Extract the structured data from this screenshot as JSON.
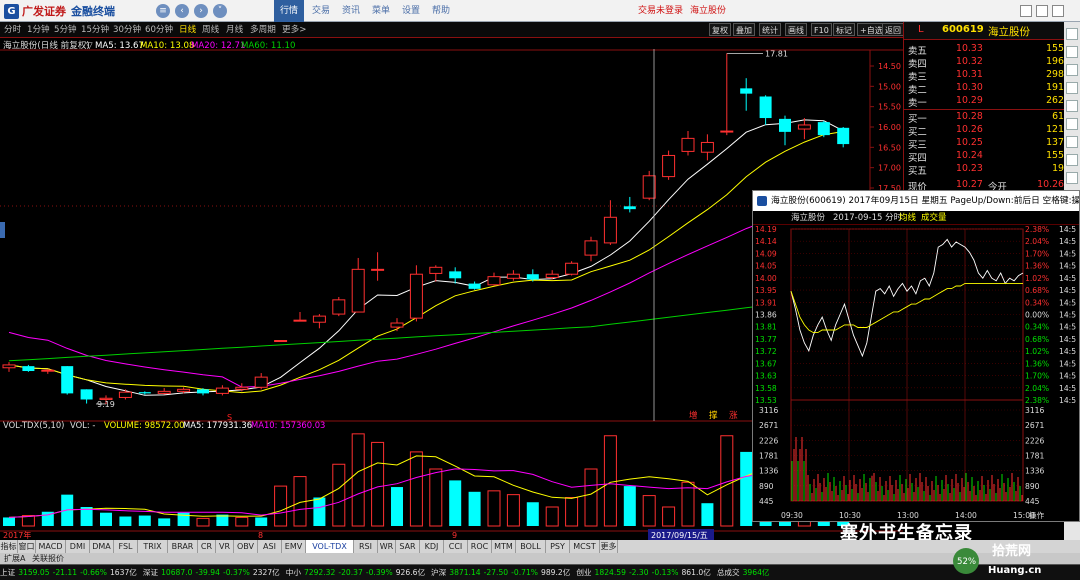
{
  "topbar": {
    "logo_cn": "广发证券",
    "logo_sub": "金融终端",
    "menus": [
      "行情",
      "交易",
      "资讯",
      "菜单",
      "设置",
      "帮助"
    ],
    "login_status": "交易未登录",
    "stock_name": "海立股份"
  },
  "period_tabs": [
    "分时",
    "1分钟",
    "5分钟",
    "15分钟",
    "30分钟",
    "60分钟",
    "日线",
    "周线",
    "月线",
    "多周期",
    "更多>"
  ],
  "active_tab": "日线",
  "toolbar": [
    "复权",
    "叠加",
    "统计",
    "画线",
    "F10",
    "标记",
    "+自选",
    "返回"
  ],
  "main": {
    "title": "海立股份(日线 前复权)",
    "arrow": "▽",
    "ma5": "MA5: 13.67",
    "ma10": "MA10: 13.08",
    "ma20": "MA20: 12.71",
    "ma60": "MA60: 11.10",
    "high_label": "17.81",
    "low_label": "9.19",
    "price_axis": [
      "17.50",
      "17.00",
      "16.50",
      "16.00",
      "15.50",
      "15.00",
      "14.50"
    ],
    "markers": [
      {
        "text": "S",
        "color": "#ff2020"
      },
      {
        "text": "增",
        "color": "#ff3030"
      },
      {
        "text": "撑",
        "color": "#ffd000"
      },
      {
        "text": "涨",
        "color": "#ff3030"
      }
    ],
    "year_label": "2017年",
    "month_labels": [
      "8",
      "9"
    ],
    "cursor_date": "2017/09/15/五"
  },
  "volume": {
    "title": "VOL-TDX(5,10)",
    "vol_name": "VOL: -",
    "volume": "VOLUME: 98572.00",
    "ma5": "MA5: 177931.36",
    "ma10": "MA10: 157360.03"
  },
  "bottom_tabs": [
    "指标",
    "窗口",
    "MACD",
    "DMI",
    "DMA",
    "FSL",
    "TRIX",
    "BRAR",
    "CR",
    "VR",
    "OBV",
    "ASI",
    "EMV",
    "VOL-TDX",
    "RSI",
    "WR",
    "SAR",
    "KDJ",
    "CCI",
    "ROC",
    "MTM",
    "BOLL",
    "PSY",
    "MCST",
    "更多"
  ],
  "active_bottom": "VOL-TDX",
  "ext_tabs": [
    "扩展A",
    "关联报价"
  ],
  "quote": {
    "badge": "L",
    "code": "600619",
    "name": "海立股份",
    "asks": [
      {
        "label": "卖五",
        "price": "10.33",
        "vol": "155"
      },
      {
        "label": "卖四",
        "price": "10.32",
        "vol": "196"
      },
      {
        "label": "卖三",
        "price": "10.31",
        "vol": "298"
      },
      {
        "label": "卖二",
        "price": "10.30",
        "vol": "191"
      },
      {
        "label": "卖一",
        "price": "10.29",
        "vol": "262"
      }
    ],
    "bids": [
      {
        "label": "买一",
        "price": "10.28",
        "vol": "61"
      },
      {
        "label": "买二",
        "price": "10.26",
        "vol": "121"
      },
      {
        "label": "买三",
        "price": "10.25",
        "vol": "137"
      },
      {
        "label": "买四",
        "price": "10.24",
        "vol": "155"
      },
      {
        "label": "买五",
        "price": "10.23",
        "vol": "19"
      }
    ],
    "last_label": "现价",
    "last": "10.27",
    "open_label": "今开",
    "open": "10.26"
  },
  "popup": {
    "title": "海立股份(600619) 2017年09月15日 星期五 PageUp/Down:前后日 空格键:操作 通",
    "sub_name": "海立股份",
    "sub_date": "2017-09-15 分时",
    "sub_avg": "均线",
    "sub_vol": "成交量",
    "price_axis": [
      "14.19",
      "14.14",
      "14.09",
      "14.05",
      "14.00",
      "13.95",
      "13.91",
      "13.86",
      "13.81",
      "13.77",
      "13.72",
      "13.67",
      "13.63",
      "13.58",
      "13.53"
    ],
    "pct_axis": [
      "2.38%",
      "2.04%",
      "1.70%",
      "1.36%",
      "1.02%",
      "0.68%",
      "0.34%",
      "0.00%",
      "0.34%",
      "0.68%",
      "1.02%",
      "1.36%",
      "1.70%",
      "2.04%",
      "2.38%"
    ],
    "vol_axis": [
      "3116",
      "2671",
      "2226",
      "1781",
      "1336",
      "890",
      "445"
    ],
    "time_axis": [
      "09:30",
      "10:30",
      "13:00",
      "14:00",
      "15:00"
    ],
    "op_label": "操作",
    "right_cut": "14:5"
  },
  "status_bar": [
    {
      "label": "上证",
      "value": "3159.05",
      "chg": "-21.11",
      "pct": "-0.66%",
      "amt": "1637亿"
    },
    {
      "label": "深证",
      "value": "10687.0",
      "chg": "-39.94",
      "pct": "-0.37%",
      "amt": "2327亿"
    },
    {
      "label": "中小",
      "value": "7292.32",
      "chg": "-20.37",
      "pct": "-0.39%",
      "amt": "926.6亿"
    },
    {
      "label": "沪深",
      "value": "3871.14",
      "chg": "-27.50",
      "pct": "-0.71%",
      "amt": "989.2亿"
    },
    {
      "label": "创业",
      "value": "1824.59",
      "chg": "-2.30",
      "pct": "-0.13%",
      "amt": "861.0亿"
    },
    {
      "label": "总成交",
      "value": "3964亿",
      "chg": "",
      "pct": "",
      "amt": ""
    }
  ],
  "watermark": "塞外书生备忘录",
  "right_labels": {
    "badge": "52%",
    "site": "Huang.cn",
    "site_cn": "拾荒网",
    "time": "6:54",
    "lev": "领航"
  },
  "colors": {
    "up": "#ff3030",
    "down": "#00ffff",
    "ma5": "#ffffff",
    "ma10": "#ffff00",
    "ma20": "#ff00ff",
    "ma60": "#00d000",
    "grid": "#8a1010"
  },
  "chart_data": [
    {
      "type": "candlestick",
      "title": "海立股份(日线 前复权)",
      "series": [
        {
          "name": "MA5",
          "last": 13.67
        },
        {
          "name": "MA10",
          "last": 13.08
        },
        {
          "name": "MA20",
          "last": 12.71
        },
        {
          "name": "MA60",
          "last": 11.1
        }
      ],
      "y_ticks": [
        14.5,
        15,
        15.5,
        16,
        16.5,
        17,
        17.5
      ],
      "high": 17.81,
      "low": 9.19,
      "candles": [
        [
          10.08,
          10.15,
          10.22,
          9.98
        ],
        [
          10.12,
          10.0,
          10.15,
          9.98
        ],
        [
          10.0,
          10.02,
          10.05,
          9.93
        ],
        [
          10.12,
          9.45,
          10.12,
          9.42
        ],
        [
          9.55,
          9.3,
          9.55,
          9.2
        ],
        [
          9.3,
          9.33,
          9.4,
          9.19
        ],
        [
          9.35,
          9.48,
          9.55,
          9.3
        ],
        [
          9.48,
          9.45,
          9.5,
          9.42
        ],
        [
          9.45,
          9.5,
          9.58,
          9.42
        ],
        [
          9.5,
          9.55,
          9.6,
          9.45
        ],
        [
          9.55,
          9.45,
          9.58,
          9.4
        ],
        [
          9.45,
          9.58,
          9.65,
          9.4
        ],
        [
          9.55,
          9.6,
          9.7,
          9.5
        ],
        [
          9.6,
          9.85,
          9.95,
          9.55
        ],
        [
          10.75,
          10.75,
          10.75,
          10.75
        ],
        [
          11.25,
          11.25,
          11.45,
          11.25
        ],
        [
          11.2,
          11.35,
          11.4,
          11.05
        ],
        [
          11.4,
          11.75,
          11.82,
          11.35
        ],
        [
          11.45,
          12.5,
          12.78,
          11.45
        ],
        [
          12.5,
          12.5,
          12.92,
          12.22
        ],
        [
          11.08,
          11.18,
          11.3,
          10.98
        ],
        [
          11.3,
          12.38,
          12.6,
          11.22
        ],
        [
          12.4,
          12.55,
          12.6,
          12.2
        ],
        [
          12.45,
          12.28,
          12.55,
          12.15
        ],
        [
          12.15,
          12.02,
          12.2,
          12.0
        ],
        [
          12.12,
          12.32,
          12.42,
          12.1
        ],
        [
          12.28,
          12.38,
          12.48,
          12.22
        ],
        [
          12.38,
          12.25,
          12.5,
          12.2
        ],
        [
          12.3,
          12.38,
          12.48,
          12.25
        ],
        [
          12.38,
          12.65,
          12.7,
          12.35
        ],
        [
          12.85,
          13.2,
          13.3,
          12.7
        ],
        [
          13.15,
          13.78,
          14.2,
          13.1
        ],
        [
          14.05,
          13.98,
          14.28,
          13.9
        ],
        [
          14.25,
          14.8,
          14.92,
          14.2
        ],
        [
          14.78,
          15.3,
          15.42,
          14.7
        ],
        [
          15.4,
          15.72,
          15.9,
          15.3
        ],
        [
          15.38,
          15.62,
          15.82,
          15.18
        ],
        [
          15.88,
          15.9,
          17.81,
          15.8
        ],
        [
          16.95,
          16.82,
          17.2,
          16.4
        ],
        [
          16.75,
          16.22,
          16.78,
          16.05
        ],
        [
          16.2,
          15.88,
          16.28,
          15.55
        ],
        [
          15.95,
          16.05,
          16.22,
          15.7
        ],
        [
          16.12,
          15.8,
          16.15,
          15.75
        ],
        [
          15.98,
          15.58,
          16.0,
          15.5
        ]
      ],
      "x_labels": [
        "2017年",
        "8",
        "9",
        "2017/09/15/五"
      ]
    },
    {
      "type": "bar",
      "title": "VOL-TDX(5,10)",
      "series": [
        {
          "name": "VOLUME",
          "last": 98572.0
        },
        {
          "name": "MA5",
          "last": 177931.36
        },
        {
          "name": "MA10",
          "last": 157360.03
        }
      ],
      "values": [
        {
          "v": 9,
          "up": false
        },
        {
          "v": 11,
          "up": true
        },
        {
          "v": 15,
          "up": false
        },
        {
          "v": 33,
          "up": false
        },
        {
          "v": 20,
          "up": false
        },
        {
          "v": 14,
          "up": false
        },
        {
          "v": 10,
          "up": false
        },
        {
          "v": 11,
          "up": false
        },
        {
          "v": 8,
          "up": false
        },
        {
          "v": 14,
          "up": false
        },
        {
          "v": 8,
          "up": true
        },
        {
          "v": 12,
          "up": false
        },
        {
          "v": 9,
          "up": true
        },
        {
          "v": 9,
          "up": false
        },
        {
          "v": 42,
          "up": true
        },
        {
          "v": 52,
          "up": true
        },
        {
          "v": 30,
          "up": false
        },
        {
          "v": 65,
          "up": true
        },
        {
          "v": 97,
          "up": true
        },
        {
          "v": 88,
          "up": true
        },
        {
          "v": 41,
          "up": false
        },
        {
          "v": 78,
          "up": true
        },
        {
          "v": 60,
          "up": true
        },
        {
          "v": 48,
          "up": false
        },
        {
          "v": 36,
          "up": false
        },
        {
          "v": 37,
          "up": true
        },
        {
          "v": 33,
          "up": true
        },
        {
          "v": 25,
          "up": false
        },
        {
          "v": 20,
          "up": true
        },
        {
          "v": 30,
          "up": true
        },
        {
          "v": 60,
          "up": true
        },
        {
          "v": 95,
          "up": true
        },
        {
          "v": 42,
          "up": false
        },
        {
          "v": 32,
          "up": true
        },
        {
          "v": 20,
          "up": true
        },
        {
          "v": 46,
          "up": true
        },
        {
          "v": 24,
          "up": false
        },
        {
          "v": 95,
          "up": true
        },
        {
          "v": 78,
          "up": false
        },
        {
          "v": 59,
          "up": false
        },
        {
          "v": 46,
          "up": false
        },
        {
          "v": 37,
          "up": true
        },
        {
          "v": 33,
          "up": false
        },
        {
          "v": 28,
          "up": false
        }
      ]
    },
    {
      "type": "line",
      "title": "海立股份 2017-09-15 分时",
      "y_ticks": [
        14.19,
        14.14,
        14.09,
        14.05,
        14.0,
        13.95,
        13.91,
        13.86,
        13.81,
        13.77,
        13.72,
        13.67,
        13.63,
        13.58,
        13.53
      ],
      "base_price": 13.86,
      "price": [
        13.95,
        13.88,
        13.8,
        13.75,
        13.72,
        13.78,
        13.82,
        13.85,
        13.8,
        13.76,
        13.82,
        13.86,
        13.9,
        13.84,
        13.78,
        13.74,
        13.7,
        13.75,
        13.85,
        13.95,
        13.96,
        13.94,
        13.97,
        13.93,
        13.96,
        13.98,
        13.95,
        13.97,
        13.94,
        13.99,
        14.0,
        13.97,
        14.02,
        14.12,
        14.13,
        14.15,
        14.12,
        14.14,
        14.13,
        14.12,
        14.1,
        14.07,
        14.02,
        14.0,
        14.03,
        14.0,
        13.99,
        14.02,
        13.98,
        14.0,
        13.99,
        14.01,
        14.02
      ],
      "avg": [
        13.95,
        13.9,
        13.85,
        13.82,
        13.8,
        13.79,
        13.79,
        13.8,
        13.8,
        13.8,
        13.8,
        13.81,
        13.82,
        13.82,
        13.82,
        13.81,
        13.81,
        13.81,
        13.82,
        13.83,
        13.84,
        13.85,
        13.86,
        13.87,
        13.87,
        13.88,
        13.89,
        13.9,
        13.9,
        13.91,
        13.92,
        13.92,
        13.93,
        13.94,
        13.95,
        13.96,
        13.96,
        13.97,
        13.97,
        13.98,
        13.98,
        13.98,
        13.98,
        13.98,
        13.98,
        13.98,
        13.98,
        13.98,
        13.98,
        13.98,
        13.98,
        13.98,
        13.98
      ],
      "time_labels": [
        "09:30",
        "10:30",
        "13:00",
        "14:00",
        "15:00"
      ]
    }
  ]
}
